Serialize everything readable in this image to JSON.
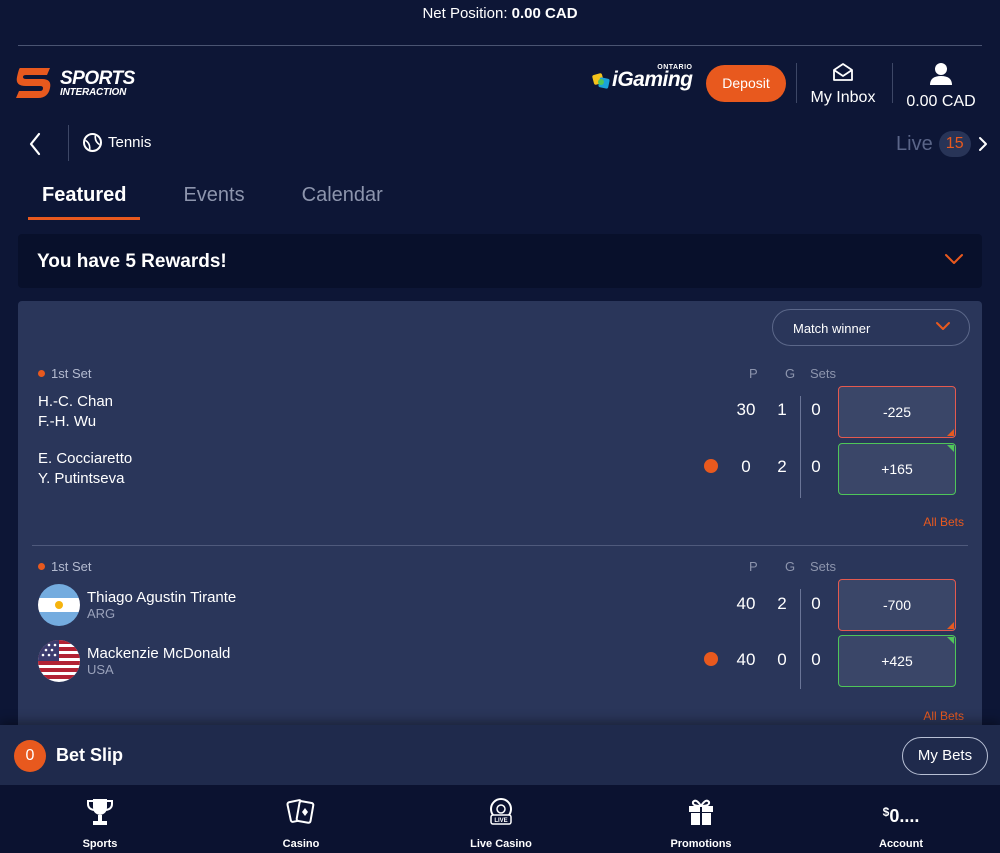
{
  "net_position": {
    "label": "Net Position:",
    "value": "0.00 CAD"
  },
  "header": {
    "logo": {
      "line1": "SPORTS",
      "line2": "INTERACTION"
    },
    "regulator": {
      "word": "iGaming",
      "region": "ONTARIO"
    },
    "deposit_label": "Deposit",
    "inbox_label": "My Inbox",
    "balance": "0.00 CAD"
  },
  "subnav": {
    "sport": "Tennis",
    "live_label": "Live",
    "live_count": "15"
  },
  "tabs": [
    {
      "label": "Featured",
      "active": true
    },
    {
      "label": "Events",
      "active": false
    },
    {
      "label": "Calendar",
      "active": false
    }
  ],
  "rewards": {
    "text": "You have 5 Rewards!"
  },
  "market_select": {
    "selected": "Match winner"
  },
  "columns": {
    "points": "P",
    "games": "G",
    "sets": "Sets"
  },
  "events": [
    {
      "status": "1st Set",
      "participants": [
        {
          "name_line1": "H.-C. Chan",
          "name_line2": "F.-H. Wu",
          "p": "30",
          "g": "1",
          "sets": "0",
          "odds": "-225",
          "trend": "down",
          "serving": false
        },
        {
          "name_line1": "E. Cocciaretto",
          "name_line2": "Y. Putintseva",
          "p": "0",
          "g": "2",
          "sets": "0",
          "odds": "+165",
          "trend": "up",
          "serving": true
        }
      ],
      "all_bets": "All Bets"
    },
    {
      "status": "1st Set",
      "participants": [
        {
          "name": "Thiago Agustin Tirante",
          "country": "ARG",
          "flag": "argentina-flag",
          "p": "40",
          "g": "2",
          "sets": "0",
          "odds": "-700",
          "trend": "down",
          "serving": false
        },
        {
          "name": "Mackenzie McDonald",
          "country": "USA",
          "flag": "usa-flag",
          "p": "40",
          "g": "0",
          "sets": "0",
          "odds": "+425",
          "trend": "up",
          "serving": true
        }
      ],
      "all_bets": "All Bets"
    }
  ],
  "betslip": {
    "count": "0",
    "label": "Bet Slip",
    "my_bets": "My Bets"
  },
  "bottom_nav": [
    {
      "label": "Sports",
      "icon": "trophy-icon"
    },
    {
      "label": "Casino",
      "icon": "cards-icon"
    },
    {
      "label": "Live Casino",
      "icon": "live-casino-icon"
    },
    {
      "label": "Promotions",
      "icon": "gift-icon"
    },
    {
      "label": "Account",
      "amount_symbol": "$",
      "amount": "0...."
    }
  ],
  "colors": {
    "accent": "#e8591e",
    "background": "#0d1636",
    "panel": "#2a365a",
    "odds_down": "#e45a4f",
    "odds_up": "#4fc659"
  }
}
